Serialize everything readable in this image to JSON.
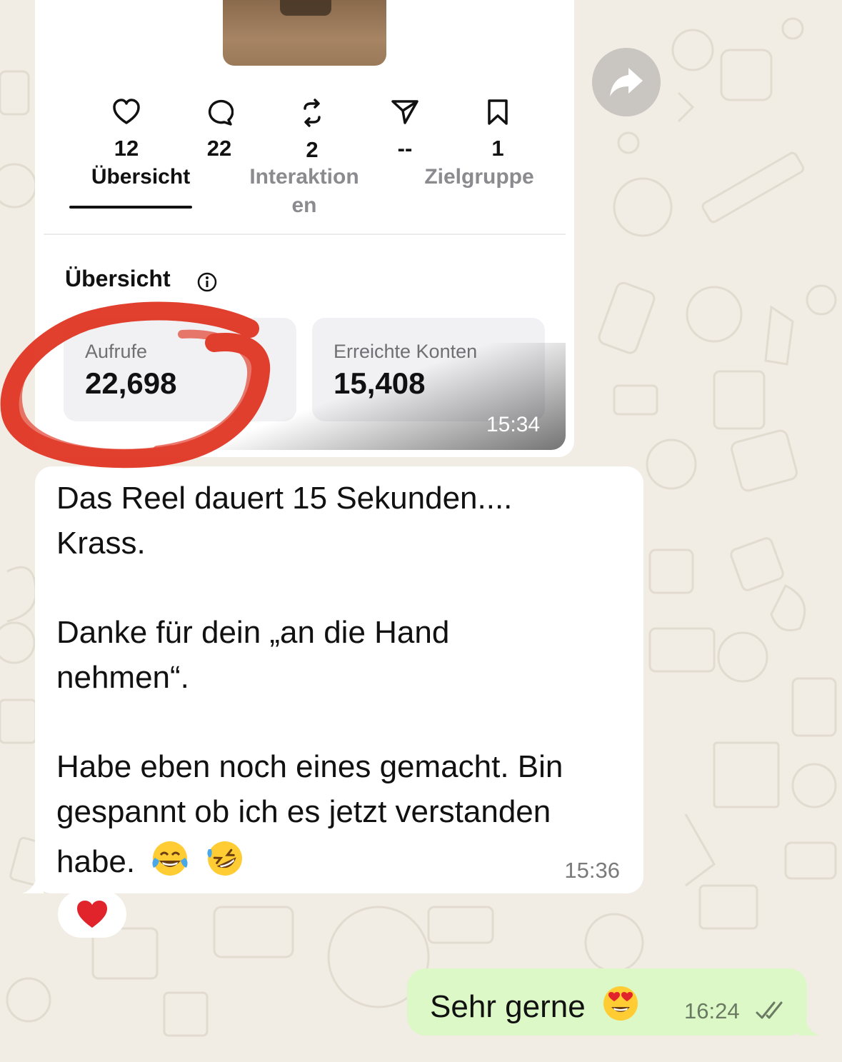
{
  "image_message": {
    "stats": [
      {
        "icon": "heart-icon",
        "value": "12"
      },
      {
        "icon": "comment-icon",
        "value": "22"
      },
      {
        "icon": "repost-icon",
        "value": "2"
      },
      {
        "icon": "share-icon",
        "value": "--"
      },
      {
        "icon": "bookmark-icon",
        "value": "1"
      }
    ],
    "tabs": [
      {
        "label": "Übersicht",
        "active": true
      },
      {
        "label": "Interaktion",
        "label2": "en",
        "active": false
      },
      {
        "label": "Zielgruppe",
        "active": false
      }
    ],
    "section_title": "Übersicht",
    "cards": [
      {
        "label": "Aufrufe",
        "value": "22,698"
      },
      {
        "label": "Erreichte Konten",
        "value": "15,408"
      }
    ],
    "time": "15:34",
    "annotation_color": "#e0301e"
  },
  "text_message": {
    "lines": [
      "Das Reel dauert 15 Sekunden....",
      "Krass.",
      "",
      "Danke für dein „an die Hand",
      "nehmen“.",
      "",
      "Habe eben noch eines gemacht. Bin",
      "gespannt ob ich es jetzt verstanden",
      "habe."
    ],
    "trailing_emojis": [
      "😂",
      "🤣"
    ],
    "time": "15:36",
    "reaction": "❤️"
  },
  "outgoing_message": {
    "text": "Sehr gerne",
    "emoji": "😍",
    "time": "16:24",
    "status_icon": "double-check-icon"
  },
  "colors": {
    "wallpaper": "#f1ece4",
    "incoming_bubble": "#ffffff",
    "outgoing_bubble": "#dcf8c6",
    "forward_button": "#c9c5c0"
  }
}
